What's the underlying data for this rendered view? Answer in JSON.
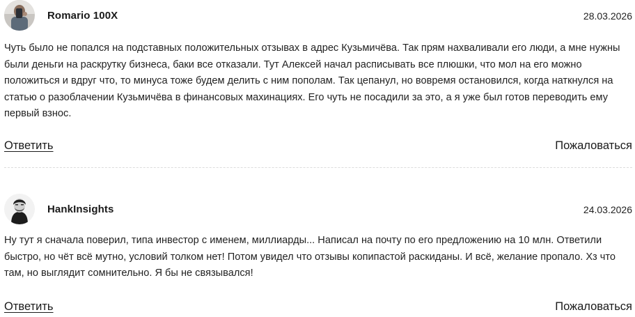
{
  "comments": [
    {
      "author": "Romario 100X",
      "date": "28.03.2026",
      "text": "Чуть было не попался на подставных положительных отзывах в адрес Кузьмичёва. Так прям нахваливали его люди, а мне нужны были деньги на раскрутку бизнеса, баки все отказали. Тут Алексей начал расписывать все плюшки, что мол на его можно положиться и вдруг что, то минуса тоже будем делить с ним пополам. Так цепанул, но вовремя остановился, когда наткнулся на статью о разоблачении Кузьмичёва в финансовых махинациях. Его чуть не посадили за это, а я уже был готов переводить ему первый взнос.",
      "reply_label": "Ответить",
      "report_label": "Пожаловаться"
    },
    {
      "author": "HankInsights",
      "date": "24.03.2026",
      "text": "Ну тут я сначала поверил, типа инвестор с именем, миллиарды... Написал на почту по его предложению на 10 млн. Ответили быстро, но чёт всё мутно, условий толком нет! Потом увидел что отзывы копипастой раскиданы. И всё, желание пропало. Хз что там, но выглядит сомнительно. Я бы не связывался!",
      "reply_label": "Ответить",
      "report_label": "Пожаловаться"
    }
  ]
}
